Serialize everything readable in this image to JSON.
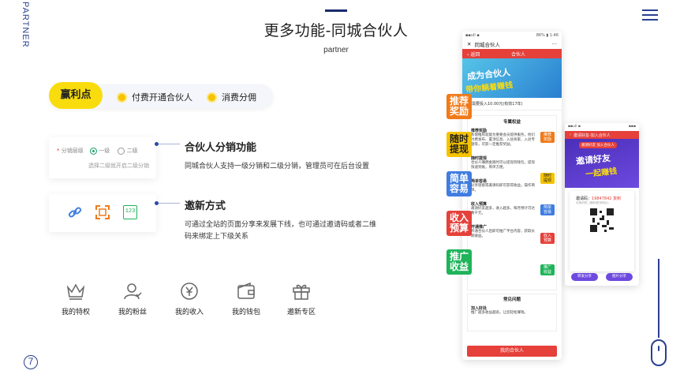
{
  "side_label": "PARTNER",
  "page_number": "7",
  "header": {
    "title": "更多功能-同城合伙人",
    "subtitle": "partner"
  },
  "benefits": {
    "label": "赢利点",
    "items": [
      "付费开通合伙人",
      "消费分佣"
    ]
  },
  "feature1": {
    "form": {
      "field_label": "分销层级",
      "option1": "一级",
      "option2": "二级",
      "hint": "选择二级就开启二级分销"
    },
    "title": "合伙人分销功能",
    "desc": "同城合伙人支持一级分销和二级分销，管理员可在后台设置"
  },
  "feature2": {
    "icons": [
      "link-icon",
      "scan-icon",
      "code-icon"
    ],
    "icon_code_text": "123",
    "title": "邀新方式",
    "desc_line1": "可通过全站的页面分享来发展下线，也可通过邀请码或者二维",
    "desc_line2": "码来绑定上下级关系"
  },
  "bottom_icons": [
    {
      "label": "我的特权",
      "icon": "crown-icon"
    },
    {
      "label": "我的粉丝",
      "icon": "fans-icon"
    },
    {
      "label": "我的收入",
      "icon": "income-icon"
    },
    {
      "label": "我的钱包",
      "icon": "wallet-icon"
    },
    {
      "label": "邀新专区",
      "icon": "gift-icon"
    }
  ],
  "phone1": {
    "status_left": "▪▪ull ▪",
    "status_right": "86% ▮ 1:46",
    "app_title": "同城合伙人",
    "back": "返回",
    "page_title": "合伙人",
    "banner_line1": "成为合伙人",
    "banner_line2": "带你躺着赚钱",
    "price_text": "需要投入10.00元(有效17年)",
    "section_title": "专属权益",
    "sections": [
      {
        "title": "推荐奖励",
        "text": "有偿推荐就能为重要会员提供服务，他们付费发布、置顶信息、入驻商家、入驻专题等，可获一定推荐奖励。"
      },
      {
        "title": "随时提现",
        "text": "合伙人赚佣金随时可以提现到钱包，提现快速到账，简单方便。"
      },
      {
        "title": "简单容易",
        "text": "分享链接或邀请码即可获得收益，操作简单。"
      },
      {
        "title": "收入预算",
        "text": "邀请好友越多，收入越多，每月预计可达数千元。"
      },
      {
        "title": "开通推广",
        "text": "开通合伙人后即可推广平台内容，获取长期收益。"
      }
    ],
    "faq_title": "常见问题",
    "faq_item": "加入好处",
    "faq_text": "推广越多收益越高，让您轻松赚钱。",
    "button": "我的合伙人"
  },
  "tags": [
    "推荐奖励",
    "随时提现",
    "简单容易",
    "收入预算",
    "推广收益"
  ],
  "mini_tags": [
    "推荐奖励",
    "随时提现",
    "简单容易",
    "收入预算",
    "推广收益"
  ],
  "phone2": {
    "status_left": "▪▪ull ▪",
    "status_right": "▪▪▪",
    "header": "邀请好友-加入合伙人",
    "sub_banner": "邀请好友 加入合伙人",
    "banner_line1": "邀请好友",
    "banner_line2": "一起赚钱",
    "invite_label": "邀请码：",
    "invite_code": "19847842",
    "copy": "复制",
    "qr_hint": "长按识别二维码或扫码加入",
    "btn1": "转发分享",
    "btn2": "图片分享"
  },
  "colors": {
    "accent": "#2b3f8f",
    "yellow": "#f9dc0d",
    "red": "#e5403a",
    "tag_orange": "#f07a1a",
    "tag_yellow": "#f6c300",
    "tag_blue": "#3f7de0",
    "tag_red": "#e5403a",
    "tag_green": "#1fb45a"
  }
}
